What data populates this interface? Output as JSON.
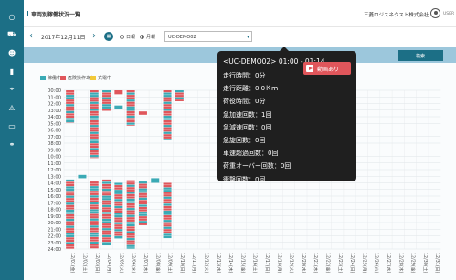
{
  "header": {
    "title": "車両別稼働状況一覧",
    "company": "三菱ロジスネクスト株式会社",
    "user": "USER",
    "exit_icon": "exit-icon"
  },
  "sidebar": {
    "icons": [
      "circle-icon",
      "vehicle-icon",
      "person-icon",
      "chart-icon",
      "location-icon",
      "warning-icon",
      "card-icon",
      "link-icon"
    ]
  },
  "toolbar": {
    "prev": "‹",
    "next": "›",
    "date": "2017年12月11日",
    "calendar_icon": "calendar-icon",
    "radio_daily": "日報",
    "radio_monthly": "月報",
    "selected_mode": "monthly",
    "vehicle": "UC-DEMO02",
    "search_label": "検索"
  },
  "legend": {
    "items": [
      {
        "label": "稼働中",
        "color": "#3aaab5"
      },
      {
        "label": "危険操作あり",
        "color": "#e0565b"
      },
      {
        "label": "充電中",
        "color": "#f2c93a"
      }
    ]
  },
  "chart_data": {
    "type": "heatmap",
    "y_labels": [
      "00:00",
      "01:00",
      "02:00",
      "03:00",
      "04:00",
      "05:00",
      "06:00",
      "07:00",
      "08:00",
      "09:00",
      "10:00",
      "11:00",
      "12:00",
      "13:00",
      "14:00",
      "15:00",
      "16:00",
      "17:00",
      "18:00",
      "19:00",
      "20:00",
      "21:00",
      "22:00",
      "23:00",
      "24:00"
    ],
    "x_labels": [
      "12/01(金)",
      "12/02(土)",
      "12/03(日)",
      "12/04(月)",
      "12/05(火)",
      "12/06(水)",
      "12/07(木)",
      "12/08(金)",
      "12/09(土)",
      "12/10(日)",
      "12/11(月)",
      "12/12(火)",
      "12/13(水)",
      "12/14(木)",
      "12/15(金)",
      "12/16(土)",
      "12/17(日)",
      "12/18(月)",
      "12/19(火)",
      "12/20(水)",
      "12/21(木)",
      "12/22(金)",
      "12/23(土)",
      "12/24(日)",
      "12/25(月)",
      "12/26(火)",
      "12/27(水)",
      "12/28(木)",
      "12/29(金)",
      "12/30(土)",
      "12/31(日)"
    ],
    "series": [
      {
        "name": "稼働中",
        "color": "#3aaab5"
      },
      {
        "name": "危険操作あり",
        "color": "#e0565b"
      },
      {
        "name": "充電中",
        "color": "#f2c93a"
      }
    ],
    "blocks": [
      {
        "day": 0,
        "start": 0,
        "end": 5,
        "state": "mixed"
      },
      {
        "day": 0,
        "start": 13.5,
        "end": 24,
        "state": "mixed"
      },
      {
        "day": 1,
        "start": 12.8,
        "end": 13.3,
        "state": "running"
      },
      {
        "day": 2,
        "start": 0,
        "end": 10.3,
        "state": "mixed"
      },
      {
        "day": 2,
        "start": 13.8,
        "end": 24,
        "state": "mixed"
      },
      {
        "day": 3,
        "start": 0,
        "end": 3.2,
        "state": "mixed"
      },
      {
        "day": 3,
        "start": 13.5,
        "end": 23.5,
        "state": "mixed"
      },
      {
        "day": 4,
        "start": 0,
        "end": 0.6,
        "state": "danger"
      },
      {
        "day": 4,
        "start": 2.3,
        "end": 2.8,
        "state": "running"
      },
      {
        "day": 4,
        "start": 14,
        "end": 22.5,
        "state": "mixed"
      },
      {
        "day": 5,
        "start": 0,
        "end": 5.4,
        "state": "mixed"
      },
      {
        "day": 5,
        "start": 13.6,
        "end": 24,
        "state": "mixed"
      },
      {
        "day": 6,
        "start": 3.2,
        "end": 3.7,
        "state": "danger"
      },
      {
        "day": 6,
        "start": 13.8,
        "end": 20.5,
        "state": "mixed"
      },
      {
        "day": 7,
        "start": 13.3,
        "end": 14.0,
        "state": "running"
      },
      {
        "day": 8,
        "start": 0,
        "end": 7.5,
        "state": "mixed"
      },
      {
        "day": 8,
        "start": 14,
        "end": 22.4,
        "state": "mixed"
      },
      {
        "day": 9,
        "start": 0,
        "end": 1.7,
        "state": "mixed"
      }
    ]
  },
  "popup": {
    "title": "<UC-DEMO02> 01:00 - 01:14",
    "video_label": "動画あり",
    "video_icon": "play-icon",
    "lines": [
      "走行時間：0分",
      "走行距離：0.0Ｋｍ",
      "荷役時間：0分",
      "急加速回数：1回",
      "急減速回数：0回",
      "急旋回数：0回",
      "車速超過回数：0回",
      "荷重オーバー回数：0回",
      "衝撃回数：0回"
    ]
  }
}
